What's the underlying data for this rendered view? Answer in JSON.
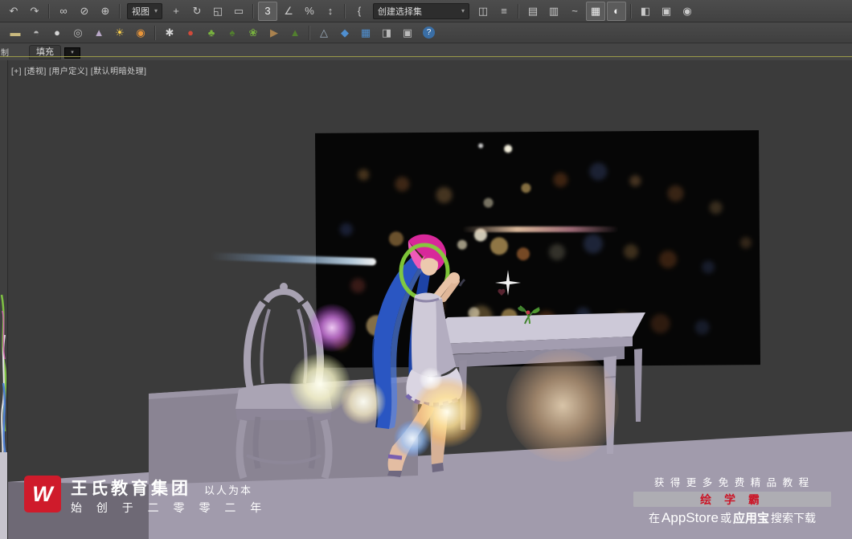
{
  "toolbar1": {
    "group_a": [
      "↶",
      "↷",
      "∞",
      "⊘",
      "⊕"
    ],
    "view_dropdown": "视图",
    "group_b": [
      "+",
      "↻",
      "◱",
      "▭",
      "3",
      "∠",
      "%",
      "↕",
      "{"
    ],
    "selection_set": "创建选择集",
    "group_c": [
      "◫",
      "≡",
      "▤",
      "▥",
      "~",
      "▦",
      "◐",
      "◧",
      "▣",
      "◉"
    ],
    "chevron": "▾"
  },
  "toolbar2": {
    "icons": [
      "▬",
      "◓",
      "●",
      "◎",
      "▲",
      "☀",
      "◉",
      "✱",
      "●",
      "♣",
      "♠",
      "❀",
      "▶",
      "▲",
      "△",
      "◆",
      "▦",
      "◨",
      "▣"
    ],
    "help": "?"
  },
  "tabs": {
    "fill": "填充",
    "left_clip": "制",
    "mini_chevron": "▾"
  },
  "viewport": {
    "label": "[+] [透视] [用户定义] [默认明暗处理]"
  },
  "watermarks": {
    "left": {
      "logo": "W",
      "brand": "王氏教育集团",
      "slogan": "以人为本",
      "since": "始 创 于 二 零 零 二 年"
    },
    "right": {
      "line1": "获 得 更 多 免 费 精 品 教 程",
      "app_name": "绘 学 霸",
      "line2_pre": "在",
      "line2_store1": "AppStore",
      "line2_or": "或",
      "line2_store2": "应用宝",
      "line2_post": "搜索下载"
    }
  },
  "colors": {
    "accent_red": "#cf1b2b",
    "highlight_bar": "#aeadb3",
    "viewport_bg": "#3b3b3b"
  }
}
